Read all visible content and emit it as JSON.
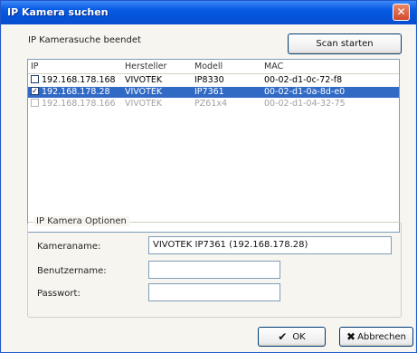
{
  "window": {
    "title": "IP Kamera suchen",
    "close_icon": "✕"
  },
  "status_text": "IP Kamerasuche beendet",
  "scan_button": "Scan starten",
  "list": {
    "columns": [
      "IP",
      "Hersteller",
      "Modell",
      "MAC"
    ],
    "rows": [
      {
        "ip": "192.168.178.168",
        "vendor": "VIVOTEK",
        "model": "IP8330",
        "mac": "00-02-d1-0c-72-f8",
        "checked": false,
        "selected": false,
        "dimmed": false
      },
      {
        "ip": "192.168.178.28",
        "vendor": "VIVOTEK",
        "model": "IP7361",
        "mac": "00-02-d1-0a-8d-e0",
        "checked": true,
        "selected": true,
        "dimmed": false
      },
      {
        "ip": "192.168.178.166",
        "vendor": "VIVOTEK",
        "model": "PZ61x4",
        "mac": "00-02-d1-04-32-75",
        "checked": false,
        "selected": false,
        "dimmed": true
      }
    ]
  },
  "options": {
    "title": "IP Kamera Optionen",
    "camera_name_label": "Kameraname:",
    "camera_name_value": "VIVOTEK IP7361 (192.168.178.28)",
    "username_label": "Benutzername:",
    "username_value": "",
    "password_label": "Passwort:",
    "password_value": ""
  },
  "ok_button": {
    "icon": "✔",
    "label": "OK"
  },
  "cancel_button": {
    "icon": "✖",
    "label": "Abbrechen"
  }
}
